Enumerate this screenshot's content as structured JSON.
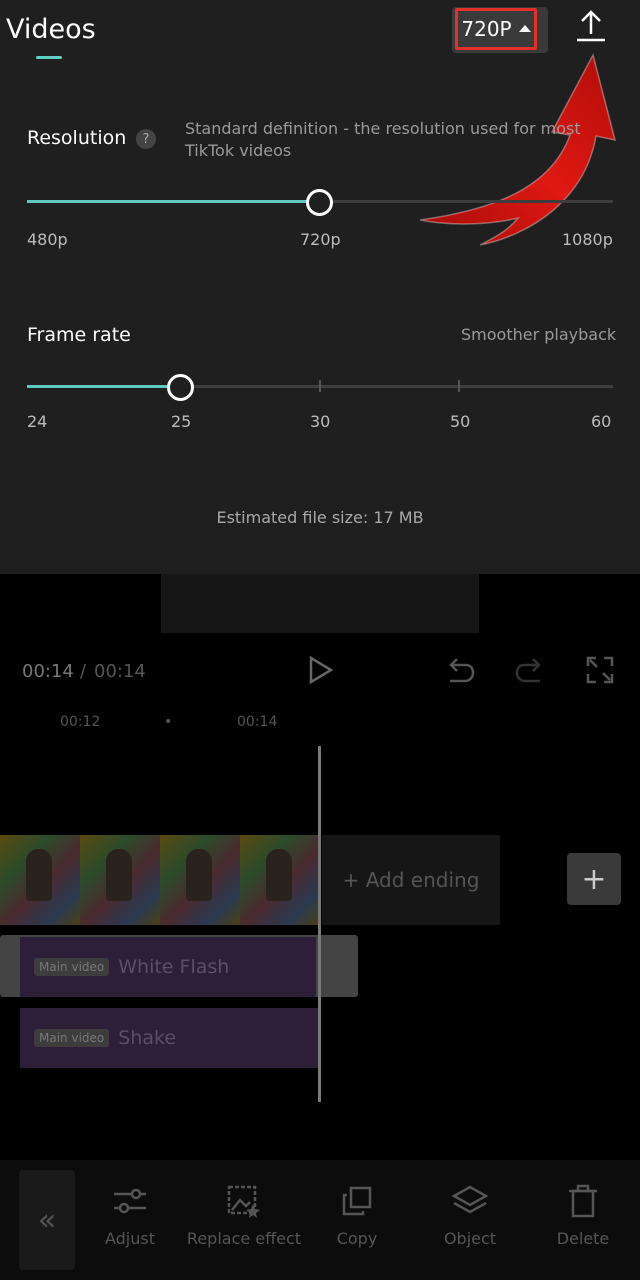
{
  "header": {
    "title": "Videos",
    "resolution_button": "720P",
    "export_icon": "upload-icon"
  },
  "resolution": {
    "label": "Resolution",
    "help": "?",
    "description_line1": "Standard definition - the resolution used for most",
    "description_line2": "TikTok videos",
    "options": [
      "480p",
      "720p",
      "1080p"
    ],
    "selected": "720p",
    "slider_fraction": 0.5
  },
  "frame_rate": {
    "label": "Frame rate",
    "description": "Smoother playback",
    "options": [
      "24",
      "25",
      "30",
      "50",
      "60"
    ],
    "selected": "25",
    "slider_fraction": 0.25
  },
  "estimated_file_size": "Estimated file size: 17 MB",
  "player": {
    "current_time": "00:14",
    "separator": "/",
    "total_time": "00:14"
  },
  "timeline": {
    "timestamps": [
      "00:12",
      "•",
      "00:14"
    ],
    "add_ending": "+ Add ending",
    "add_button": "+",
    "effects": [
      {
        "badge": "Main video",
        "name": "White Flash"
      },
      {
        "badge": "Main video",
        "name": "Shake"
      }
    ]
  },
  "toolbar": {
    "back": "«",
    "items": [
      {
        "label": "Adjust",
        "icon": "sliders-icon"
      },
      {
        "label": "Replace effect",
        "icon": "replace-effect-icon"
      },
      {
        "label": "Copy",
        "icon": "copy-icon"
      },
      {
        "label": "Object",
        "icon": "layers-icon"
      },
      {
        "label": "Delete",
        "icon": "trash-icon"
      }
    ]
  },
  "colors": {
    "accent": "#5fc9bf",
    "highlight_border": "#e53027",
    "annotation_arrow": "#d8140f",
    "panel_bg": "#1f1f1f"
  }
}
